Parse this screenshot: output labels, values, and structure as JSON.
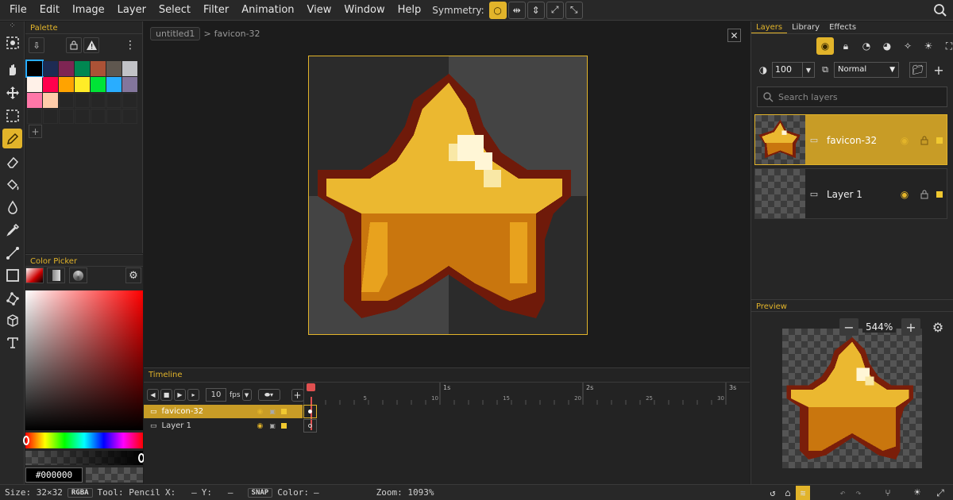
{
  "menu": [
    "File",
    "Edit",
    "Image",
    "Layer",
    "Select",
    "Filter",
    "Animation",
    "View",
    "Window",
    "Help"
  ],
  "symmetry": {
    "label": "Symmetry:"
  },
  "palette": {
    "title": "Palette",
    "colors": [
      "#000000",
      "#1d2b53",
      "#7e2553",
      "#008751",
      "#ab5236",
      "#5f574f",
      "#c2c3c7",
      "#fff1e8",
      "#ff004d",
      "#ffa300",
      "#ffec27",
      "#00e436",
      "#29adff",
      "#83769c",
      "#ff77a8",
      "#ffccaa"
    ],
    "add": "+"
  },
  "colorpicker": {
    "title": "Color Picker",
    "hex": "#000000"
  },
  "canvas": {
    "breadcrumb_file": "untitled1",
    "breadcrumb_sep": ">",
    "breadcrumb_layer": "favicon-32"
  },
  "timeline": {
    "title": "Timeline",
    "fps": "10",
    "fps_label": "fps",
    "layers": [
      "favicon-32",
      "Layer 1"
    ],
    "ticks": [
      "5",
      "10",
      "15",
      "20",
      "25",
      "30"
    ],
    "seconds": [
      "1s",
      "2s",
      "3s"
    ]
  },
  "layers": {
    "tabs": [
      "Layers",
      "Library",
      "Effects"
    ],
    "opacity": "100",
    "blend": "Normal",
    "search_placeholder": "Search layers",
    "items": [
      {
        "name": "favicon-32"
      },
      {
        "name": "Layer 1"
      }
    ]
  },
  "preview": {
    "title": "Preview",
    "zoom": "544%"
  },
  "status": {
    "size": "Size: 32×32",
    "mode": "RGBA",
    "tool": "Tool: Pencil",
    "x": "X:   –",
    "y": "Y:   –",
    "snap": "SNAP",
    "color": "Color:",
    "colorval": "–",
    "zoom": "Zoom: 1093%"
  },
  "accent": "#e2b42a"
}
